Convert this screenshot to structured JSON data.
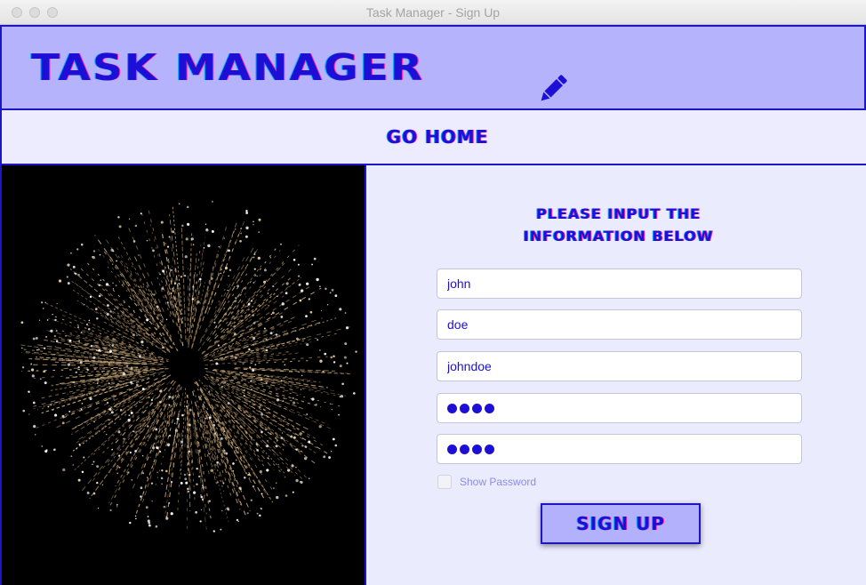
{
  "window": {
    "title": "Task Manager - Sign Up"
  },
  "header": {
    "title": "TASK MANAGER",
    "icon": "pencil-icon"
  },
  "nav": {
    "go_home_label": "GO HOME"
  },
  "image_panel": {
    "image": "fireworks-image"
  },
  "form": {
    "heading_line1": "PLEASE INPUT THE",
    "heading_line2": "INFORMATION BELOW",
    "first_name_value": "john",
    "last_name_value": "doe",
    "username_value": "johndoe",
    "password_masked": "●●●●",
    "confirm_password_masked": "●●●●",
    "show_password_label": "Show Password",
    "show_password_checked": false,
    "sign_up_label": "SIGN UP"
  },
  "colors": {
    "accent": "#1e0fd6",
    "header_bg": "#b5b3fb",
    "panel_bg": "#ebebfe",
    "border": "#1d16c9"
  }
}
